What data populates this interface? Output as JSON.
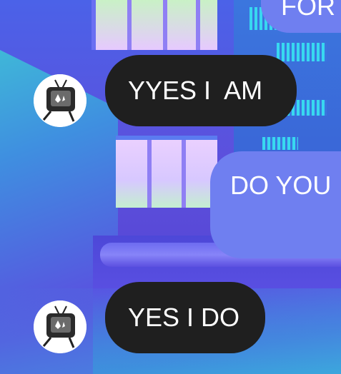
{
  "messages": [
    {
      "id": "m0",
      "side": "outgoing",
      "text": "FOR"
    },
    {
      "id": "m1",
      "side": "incoming",
      "text": "YYES I  AM"
    },
    {
      "id": "m2",
      "side": "outgoing",
      "text": "DO YOU"
    },
    {
      "id": "m3",
      "side": "incoming",
      "text": "YES I DO"
    }
  ],
  "avatar": {
    "icon": "tv-character-avatar"
  },
  "colors": {
    "incoming_bubble": "#1f1f1f",
    "outgoing_bubble": "#6f7ff0",
    "text": "#ffffff"
  }
}
